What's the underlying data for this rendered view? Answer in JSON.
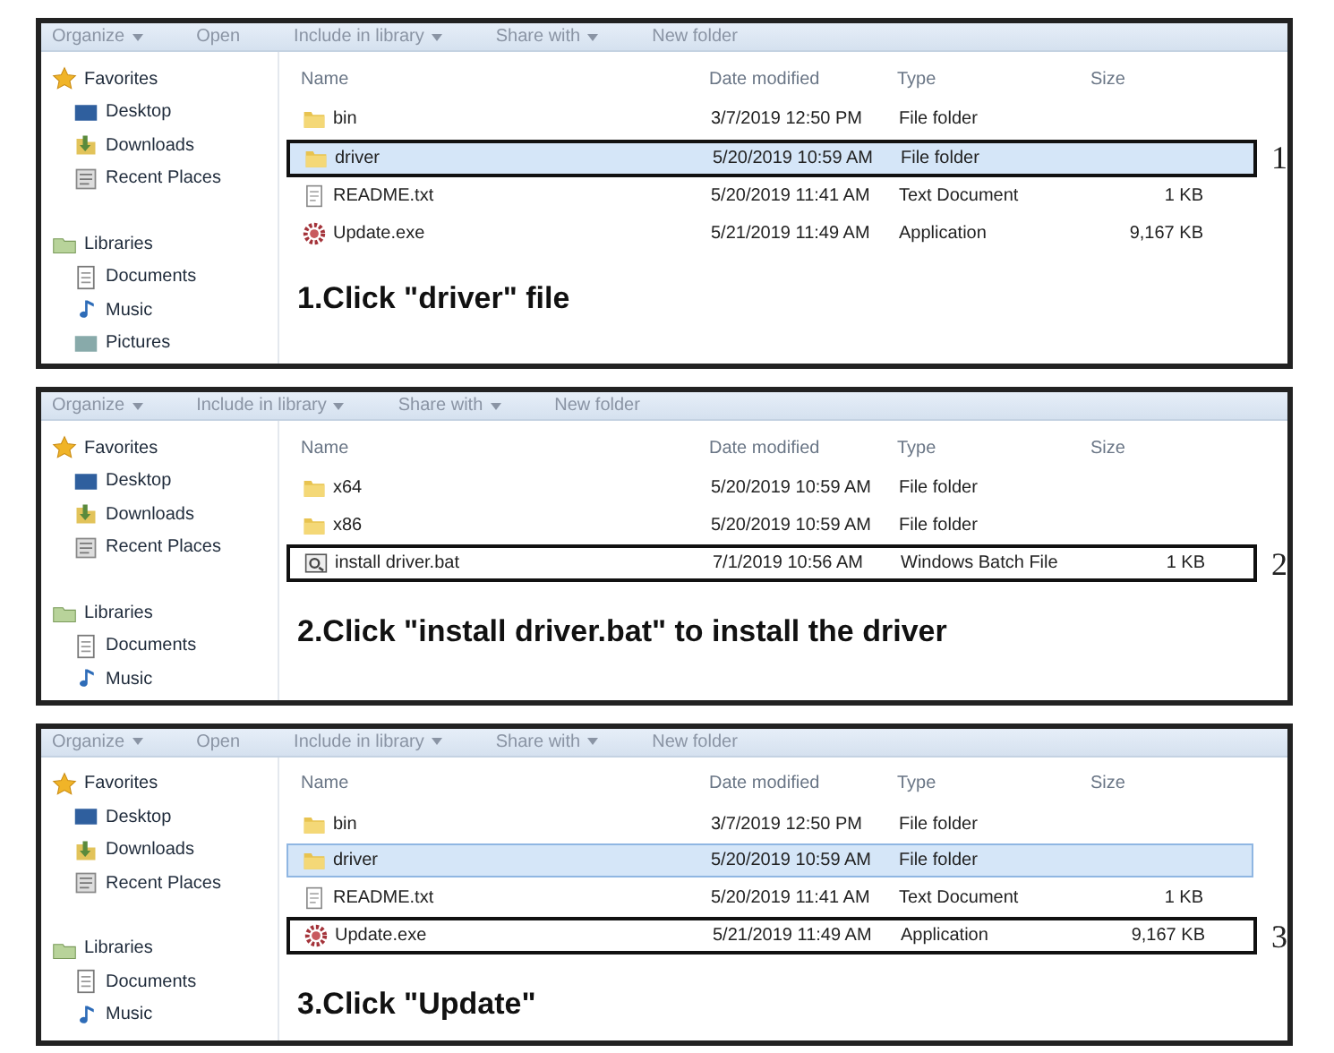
{
  "panels": [
    {
      "toolbar": [
        {
          "label": "Organize",
          "dropdown": true
        },
        {
          "label": "Open",
          "dropdown": false
        },
        {
          "label": "Include in library",
          "dropdown": true
        },
        {
          "label": "Share with",
          "dropdown": true
        },
        {
          "label": "New folder",
          "dropdown": false
        }
      ],
      "sidebar": [
        {
          "label": "Favorites",
          "kind": "group"
        },
        {
          "label": "Desktop",
          "kind": "item"
        },
        {
          "label": "Downloads",
          "kind": "item"
        },
        {
          "label": "Recent Places",
          "kind": "item"
        },
        {
          "label": "Libraries",
          "kind": "group"
        },
        {
          "label": "Documents",
          "kind": "item"
        },
        {
          "label": "Music",
          "kind": "item"
        },
        {
          "label": "Pictures",
          "kind": "item"
        }
      ],
      "columns": [
        "Name",
        "Date modified",
        "Type",
        "Size"
      ],
      "files": [
        {
          "name": "bin",
          "date": "3/7/2019 12:50 PM",
          "type": "File folder",
          "kind": "folder",
          "selected": false,
          "callout": false
        },
        {
          "name": "driver",
          "date": "5/20/2019 10:59 AM",
          "type": "File folder",
          "kind": "folder",
          "selected": true,
          "callout": true
        },
        {
          "name": "README.txt",
          "date": "5/20/2019 11:41 AM",
          "type": "Text Document",
          "size": "1 KB",
          "kind": "text",
          "selected": false,
          "callout": false
        },
        {
          "name": "Update.exe",
          "date": "5/21/2019 11:49 AM",
          "type": "Application",
          "size": "9,167 KB",
          "kind": "exe",
          "selected": false,
          "callout": false
        }
      ],
      "instruction": "1.Click \"driver\" file",
      "step_number": "1"
    },
    {
      "toolbar": [
        {
          "label": "Organize",
          "dropdown": true
        },
        {
          "label": "Include in library",
          "dropdown": true
        },
        {
          "label": "Share with",
          "dropdown": true
        },
        {
          "label": "New folder",
          "dropdown": false
        }
      ],
      "sidebar": [
        {
          "label": "Favorites",
          "kind": "group"
        },
        {
          "label": "Desktop",
          "kind": "item"
        },
        {
          "label": "Downloads",
          "kind": "item"
        },
        {
          "label": "Recent Places",
          "kind": "item"
        },
        {
          "label": "Libraries",
          "kind": "group"
        },
        {
          "label": "Documents",
          "kind": "item"
        },
        {
          "label": "Music",
          "kind": "item"
        }
      ],
      "columns": [
        "Name",
        "Date modified",
        "Type",
        "Size"
      ],
      "files": [
        {
          "name": "x64",
          "date": "5/20/2019 10:59 AM",
          "type": "File folder",
          "kind": "folder",
          "selected": false,
          "callout": false
        },
        {
          "name": "x86",
          "date": "5/20/2019 10:59 AM",
          "type": "File folder",
          "kind": "folder",
          "selected": false,
          "callout": false
        },
        {
          "name": "install driver.bat",
          "date": "7/1/2019 10:56 AM",
          "type": "Windows Batch File",
          "size": "1 KB",
          "kind": "batch",
          "selected": false,
          "callout": true
        }
      ],
      "instruction": "2.Click \"install driver.bat\" to install the driver",
      "step_number": "2"
    },
    {
      "toolbar": [
        {
          "label": "Organize",
          "dropdown": true
        },
        {
          "label": "Open",
          "dropdown": false
        },
        {
          "label": "Include in library",
          "dropdown": true
        },
        {
          "label": "Share with",
          "dropdown": true
        },
        {
          "label": "New folder",
          "dropdown": false
        }
      ],
      "sidebar": [
        {
          "label": "Favorites",
          "kind": "group"
        },
        {
          "label": "Desktop",
          "kind": "item"
        },
        {
          "label": "Downloads",
          "kind": "item"
        },
        {
          "label": "Recent Places",
          "kind": "item"
        },
        {
          "label": "Libraries",
          "kind": "group"
        },
        {
          "label": "Documents",
          "kind": "item"
        },
        {
          "label": "Music",
          "kind": "item"
        }
      ],
      "columns": [
        "Name",
        "Date modified",
        "Type",
        "Size"
      ],
      "files": [
        {
          "name": "bin",
          "date": "3/7/2019 12:50 PM",
          "type": "File folder",
          "kind": "folder",
          "selected": false,
          "callout": false
        },
        {
          "name": "driver",
          "date": "5/20/2019 10:59 AM",
          "type": "File folder",
          "kind": "folder",
          "selected": true,
          "callout": false
        },
        {
          "name": "README.txt",
          "date": "5/20/2019 11:41 AM",
          "type": "Text Document",
          "size": "1 KB",
          "kind": "text",
          "selected": false,
          "callout": false
        },
        {
          "name": "Update.exe",
          "date": "5/21/2019 11:49 AM",
          "type": "Application",
          "size": "9,167 KB",
          "kind": "exe",
          "selected": false,
          "callout": true
        }
      ],
      "instruction": "3.Click \"Update\"",
      "step_number": "3"
    }
  ]
}
